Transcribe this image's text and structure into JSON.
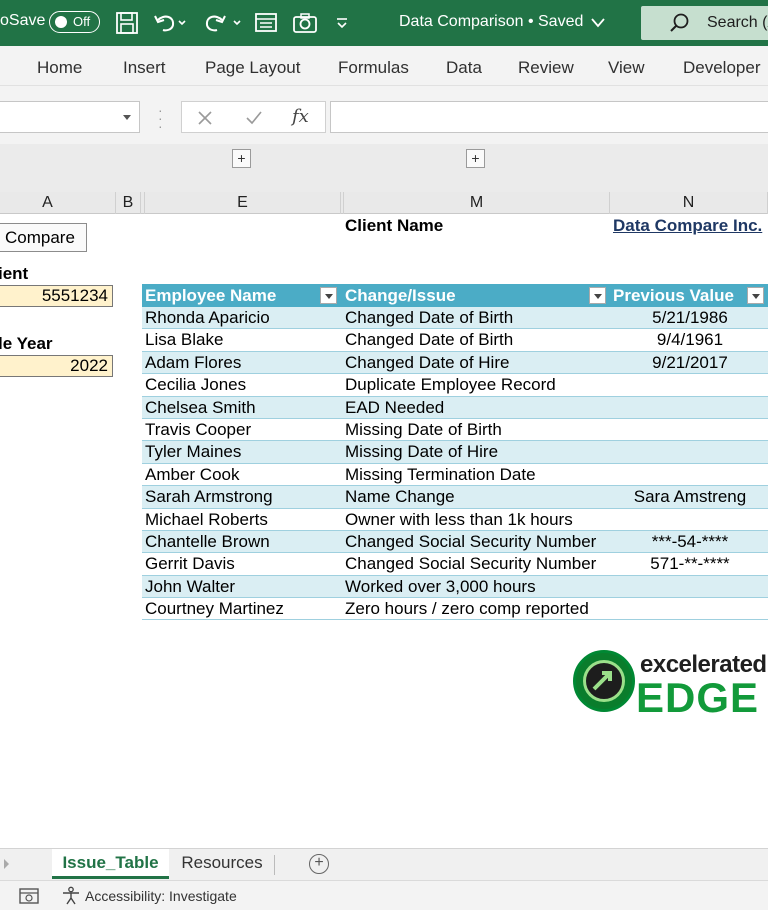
{
  "titlebar": {
    "autosave_label": "oSave",
    "toggle_state": "Off",
    "doc_title": "Data Comparison • Saved",
    "search_label": "Search (A"
  },
  "ribbon": {
    "tabs": [
      "Home",
      "Insert",
      "Page Layout",
      "Formulas",
      "Data",
      "Review",
      "View",
      "Developer"
    ]
  },
  "formula_bar": {
    "fx_label": "fx",
    "name_box": "",
    "formula": ""
  },
  "columns": [
    "A",
    "B",
    "E",
    "M",
    "N"
  ],
  "sheet": {
    "compare_button": "Compare",
    "client_label": "ient",
    "client_value": "5551234",
    "year_label": "le Year",
    "year_value": "2022",
    "client_name_label": "Client Name",
    "client_name_value": "Data Compare Inc."
  },
  "table": {
    "headers": [
      "Employee Name",
      "Change/Issue",
      "Previous Value"
    ],
    "rows": [
      [
        "Rhonda Aparicio",
        "Changed Date of Birth",
        "5/21/1986"
      ],
      [
        "Lisa Blake",
        "Changed Date of Birth",
        "9/4/1961"
      ],
      [
        "Adam Flores",
        "Changed Date of Hire",
        "9/21/2017"
      ],
      [
        "Cecilia Jones",
        "Duplicate Employee Record",
        ""
      ],
      [
        "Chelsea Smith",
        "EAD Needed",
        ""
      ],
      [
        "Travis Cooper",
        "Missing Date of Birth",
        ""
      ],
      [
        "Tyler Maines",
        "Missing Date of Hire",
        ""
      ],
      [
        "Amber Cook",
        "Missing Termination Date",
        ""
      ],
      [
        "Sarah Armstrong",
        "Name Change",
        "Sara Amstreng"
      ],
      [
        "Michael Roberts",
        "Owner with less than 1k hours",
        ""
      ],
      [
        "Chantelle Brown",
        "Changed Social Security Number",
        "***-54-****"
      ],
      [
        "Gerrit Davis",
        "Changed Social Security Number",
        "571-**-****"
      ],
      [
        "John Walter",
        "Worked over 3,000 hours",
        ""
      ],
      [
        "Courtney Martinez",
        "Zero hours / zero comp reported",
        ""
      ]
    ]
  },
  "logo": {
    "line1": "excelerated",
    "line2": "EDGE"
  },
  "sheet_tabs": [
    "Issue_Table",
    "Resources"
  ],
  "status": {
    "accessibility": "Accessibility: Investigate"
  },
  "colors": {
    "excel_green": "#217346",
    "table_header": "#4bacc6",
    "table_band": "#daeef3",
    "input_yellow": "#fff2cc",
    "logo_green": "#129a3a"
  }
}
